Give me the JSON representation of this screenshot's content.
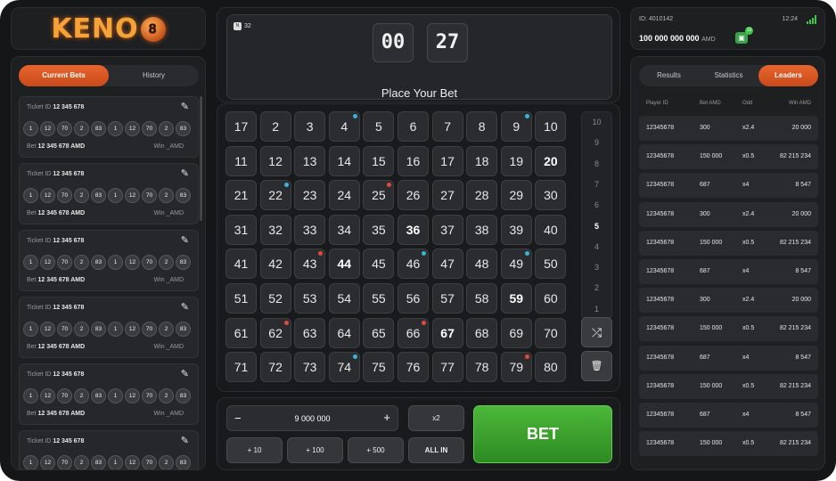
{
  "logo": {
    "text": "KENO",
    "ball": "8"
  },
  "left": {
    "tabs": [
      {
        "label": "Current Bets"
      },
      {
        "label": "History"
      }
    ],
    "tickets": [
      {
        "id_label": "Ticket ID",
        "id": "12 345 678",
        "numbers": [
          "1",
          "12",
          "70",
          "2",
          "83",
          "1",
          "12",
          "70",
          "2",
          "83"
        ],
        "bet_label": "Bet",
        "bet": "12 345 678 AMD",
        "win": "Win _AMD"
      },
      {
        "id_label": "Ticket ID",
        "id": "12 345 678",
        "numbers": [
          "1",
          "12",
          "70",
          "2",
          "83",
          "1",
          "12",
          "70",
          "2",
          "83"
        ],
        "bet_label": "Bet",
        "bet": "12 345 678 AMD",
        "win": "Win _AMD"
      },
      {
        "id_label": "Ticket ID",
        "id": "12 345 678",
        "numbers": [
          "1",
          "12",
          "70",
          "2",
          "83",
          "1",
          "12",
          "70",
          "2",
          "83"
        ],
        "bet_label": "Bet",
        "bet": "12 345 678 AMD",
        "win": "Win _AMD"
      },
      {
        "id_label": "Ticket ID",
        "id": "12 345 678",
        "numbers": [
          "1",
          "12",
          "70",
          "2",
          "83",
          "1",
          "12",
          "70",
          "2",
          "83"
        ],
        "bet_label": "Bet",
        "bet": "12 345 678 AMD",
        "win": "Win _AMD"
      },
      {
        "id_label": "Ticket ID",
        "id": "12 345 678",
        "numbers": [
          "1",
          "12",
          "70",
          "2",
          "83",
          "1",
          "12",
          "70",
          "2",
          "83"
        ],
        "bet_label": "Bet",
        "bet": "12 345 678 AMD",
        "win": "Win _AMD"
      },
      {
        "id_label": "Ticket ID",
        "id": "12 345 678",
        "numbers": [
          "1",
          "12",
          "70",
          "2",
          "83",
          "1",
          "12",
          "70",
          "2",
          "83"
        ],
        "bet_label": "Bet",
        "bet": "12 345 678 AMD",
        "win": "Win _AMD"
      }
    ]
  },
  "timer": {
    "round": "32",
    "minutes": "00",
    "seconds": "27",
    "colon": ":",
    "status": "Place Your Bet"
  },
  "grid": {
    "numbers": [
      [
        "17",
        "2",
        "3",
        "4",
        "5",
        "6",
        "7",
        "8",
        "9",
        "10"
      ],
      [
        "11",
        "12",
        "13",
        "14",
        "15",
        "16",
        "17",
        "18",
        "19",
        "20"
      ],
      [
        "21",
        "22",
        "23",
        "24",
        "25",
        "26",
        "27",
        "28",
        "29",
        "30"
      ],
      [
        "31",
        "32",
        "33",
        "34",
        "35",
        "36",
        "37",
        "38",
        "39",
        "40"
      ],
      [
        "41",
        "42",
        "43",
        "44",
        "45",
        "46",
        "47",
        "48",
        "49",
        "50"
      ],
      [
        "51",
        "52",
        "53",
        "54",
        "55",
        "56",
        "57",
        "58",
        "59",
        "60"
      ],
      [
        "61",
        "62",
        "63",
        "64",
        "65",
        "66",
        "67",
        "68",
        "69",
        "70"
      ],
      [
        "71",
        "72",
        "73",
        "74",
        "75",
        "76",
        "77",
        "78",
        "79",
        "80"
      ]
    ],
    "bold": [
      "20",
      "36",
      "44",
      "59",
      "67"
    ],
    "blue_dots": [
      "4",
      "9",
      "22",
      "46",
      "49",
      "74"
    ],
    "red_dots": [
      "25",
      "43",
      "62",
      "66",
      "79"
    ],
    "scale": [
      "10",
      "9",
      "8",
      "7",
      "6",
      "5",
      "4",
      "3",
      "2",
      "1"
    ],
    "scale_selected": "5",
    "shuffle_icon": "⤮",
    "trash_icon": "🗑"
  },
  "bet": {
    "minus": "−",
    "plus": "+",
    "amount": "9 000 000",
    "x2": "x2",
    "inc": [
      "+ 10",
      "+ 100",
      "+ 500"
    ],
    "all_in": "ALL IN",
    "bet_label": "BET"
  },
  "user": {
    "id": "ID: 4010142",
    "time": "12:24",
    "balance": "100 000 000 000",
    "currency": "AMD",
    "wallet_badge": "13"
  },
  "right": {
    "tabs": [
      {
        "label": "Results"
      },
      {
        "label": "Statistics"
      },
      {
        "label": "Leaders"
      }
    ],
    "headers": [
      "Player ID",
      "Bet AMD",
      "Odd",
      "Win AMD"
    ],
    "rows": [
      [
        "12345678",
        "300",
        "x2.4",
        "20 000"
      ],
      [
        "12345678",
        "150 000",
        "x0.5",
        "82 215 234"
      ],
      [
        "12345678",
        "687",
        "x4",
        "8 547"
      ],
      [
        "12345678",
        "300",
        "x2.4",
        "20 000"
      ],
      [
        "12345678",
        "150 000",
        "x0.5",
        "82 215 234"
      ],
      [
        "12345678",
        "687",
        "x4",
        "8 547"
      ],
      [
        "12345678",
        "300",
        "x2.4",
        "20 000"
      ],
      [
        "12345678",
        "150 000",
        "x0.5",
        "82 215 234"
      ],
      [
        "12345678",
        "687",
        "x4",
        "8 547"
      ],
      [
        "12345678",
        "150 000",
        "x0.5",
        "82 215 234"
      ],
      [
        "12345678",
        "687",
        "x4",
        "8 547"
      ],
      [
        "12345678",
        "150 000",
        "x0.5",
        "82 215 234"
      ]
    ]
  },
  "colors": {
    "accent": "#d8552a",
    "bet_green": "#3ca22c",
    "dot_blue": "#38b4d8",
    "dot_red": "#e04a3b",
    "signal": "#3ec64a"
  }
}
